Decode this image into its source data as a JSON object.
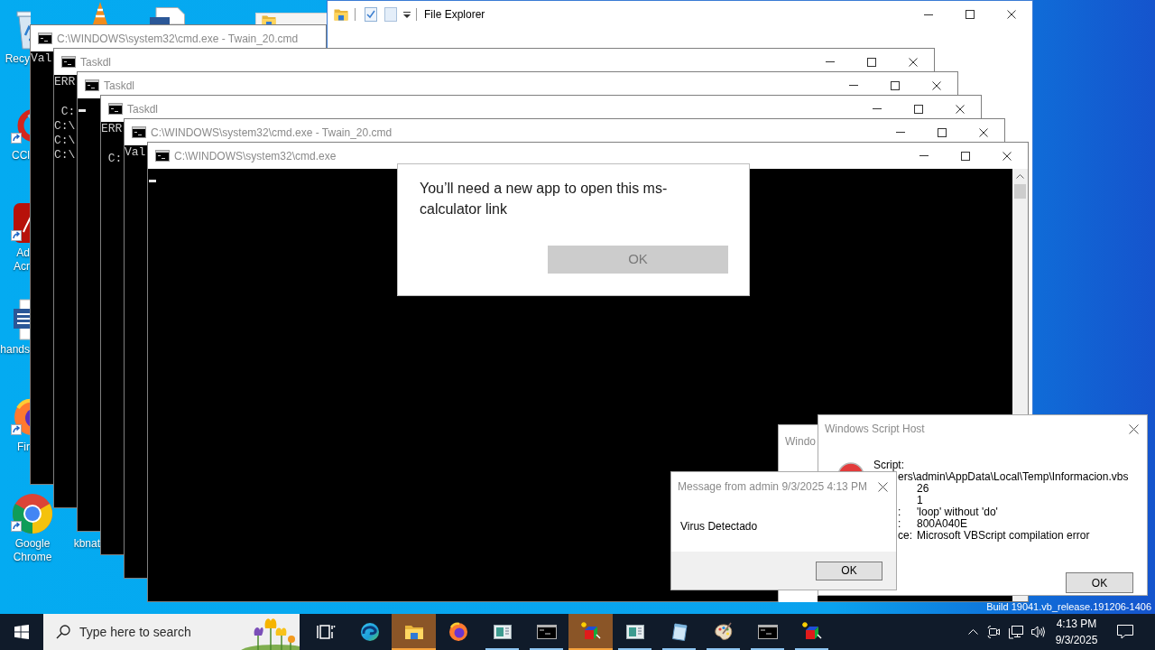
{
  "desktop": {
    "icons": [
      {
        "kind": "recycle-bin",
        "label": "Recy"
      },
      {
        "kind": "cleaner",
        "label": "CCl"
      },
      {
        "kind": "pdf",
        "label": "Ad Acr"
      },
      {
        "kind": "word",
        "label": "hands"
      },
      {
        "kind": "firefox",
        "label": "Fir"
      },
      {
        "kind": "chrome",
        "label": "Google Chrome"
      },
      {
        "kind": "covered",
        "label": "kbnat"
      }
    ],
    "build": "Build 19041.vb_release.191206-1406"
  },
  "file_explorer": {
    "title": "File Explorer"
  },
  "consoles": [
    {
      "title": "C:\\WINDOWS\\system32\\cmd.exe - Twain_20.cmd",
      "blocks": [
        [
          "Val"
        ]
      ],
      "cursor": false
    },
    {
      "title": "Taskdl",
      "blocks": [
        [
          "ERR"
        ],
        [
          " C:",
          "C:\\",
          "C:\\",
          "C:\\"
        ]
      ],
      "cursor": false
    },
    {
      "title": "Taskdl",
      "cursor": true
    },
    {
      "title": "Taskdl",
      "blocks": [
        [
          "ERR"
        ],
        [
          " C:"
        ]
      ],
      "cursor": false
    },
    {
      "title": "C:\\WINDOWS\\system32\\cmd.exe - Twain_20.cmd",
      "blocks": [
        [
          "Val"
        ]
      ],
      "cursor": false
    },
    {
      "title": "C:\\WINDOWS\\system32\\cmd.exe",
      "cursor": true
    }
  ],
  "app_dialog": {
    "message": "You’ll need a new app to open this ms-calculator link",
    "button": "OK"
  },
  "back_dialog": {
    "title": "Windo"
  },
  "script_host": {
    "title": "Windows Script Host",
    "script_label": "Script:",
    "path": "ers\\admin\\AppData\\Local\\Temp\\Informacion.vbs",
    "fields": [
      {
        "value": "26"
      },
      {
        "value": "1"
      },
      {
        "label": ":",
        "value": "'loop' without 'do'"
      },
      {
        "label": ":",
        "value": "800A040E"
      },
      {
        "label": "ce:",
        "value": "Microsoft VBScript compilation error"
      }
    ],
    "button": "OK"
  },
  "message_box": {
    "title": "Message from admin 9/3/2025 4:13 PM",
    "message": "Virus Detectado",
    "button": "OK"
  },
  "taskbar": {
    "search": {
      "placeholder": "Type here to search"
    },
    "apps": [
      {
        "kind": "task-view",
        "running": false,
        "flashing": false
      },
      {
        "kind": "edge",
        "running": false,
        "flashing": false
      },
      {
        "kind": "folder",
        "running": true,
        "flashing": true
      },
      {
        "kind": "firefox",
        "running": false,
        "flashing": false
      },
      {
        "kind": "window",
        "running": true,
        "flashing": false
      },
      {
        "kind": "console",
        "running": true,
        "flashing": false
      },
      {
        "kind": "cube",
        "running": true,
        "flashing": true
      },
      {
        "kind": "window",
        "running": true,
        "flashing": false
      },
      {
        "kind": "notepad",
        "running": true,
        "flashing": false
      },
      {
        "kind": "palette",
        "running": true,
        "flashing": false
      },
      {
        "kind": "console",
        "running": true,
        "flashing": false
      },
      {
        "kind": "cube",
        "running": true,
        "flashing": false
      }
    ],
    "clock": {
      "time": "4:13 PM",
      "date": "9/3/2025"
    }
  }
}
